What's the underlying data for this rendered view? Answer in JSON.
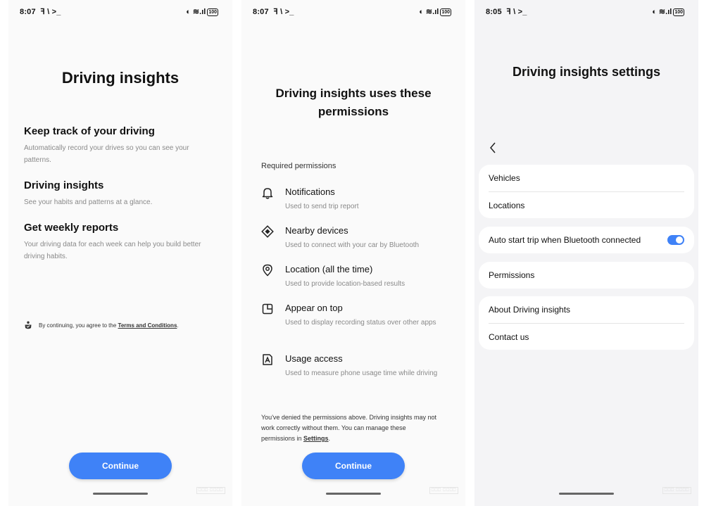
{
  "screen1": {
    "status_time": "8:07",
    "status_icons": "ꟻ \\ >_",
    "battery": "100",
    "title": "Driving insights",
    "features": [
      {
        "title": "Keep track of your driving",
        "desc": "Automatically record your drives so you can see your patterns."
      },
      {
        "title": "Driving insights",
        "desc": "See your habits and patterns at a glance."
      },
      {
        "title": "Get weekly reports",
        "desc": "Your driving data for each week can help you build better driving habits."
      }
    ],
    "terms_prefix": "By continuing, you agree to the ",
    "terms_link": "Terms and Conditions",
    "terms_suffix": ".",
    "continue_label": "Continue"
  },
  "screen2": {
    "status_time": "8:07",
    "status_icons": "ꟻ \\ >_",
    "battery": "100",
    "title_line1": "Driving insights uses these",
    "title_line2": "permissions",
    "required_label": "Required permissions",
    "permissions": [
      {
        "icon": "bell-icon",
        "title": "Notifications",
        "desc": "Used to send trip report"
      },
      {
        "icon": "nearby-devices-icon",
        "title": "Nearby devices",
        "desc": "Used to connect with your car by Bluetooth"
      },
      {
        "icon": "location-pin-icon",
        "title": "Location (all the time)",
        "desc": "Used to provide location-based results"
      },
      {
        "icon": "appear-on-top-icon",
        "title": "Appear on top",
        "desc": "Used to display recording status over other apps"
      },
      {
        "icon": "usage-access-icon",
        "title": "Usage access",
        "desc": "Used to measure phone usage time while driving"
      }
    ],
    "denied_text": "You've denied the permissions above. Driving insights may not work correctly without them. You can manage these permissions in ",
    "settings_link": "Settings",
    "denied_suffix": ".",
    "continue_label": "Continue"
  },
  "screen3": {
    "status_time": "8:05",
    "status_icons": "ꟻ \\ >_",
    "battery": "100",
    "title": "Driving insights settings",
    "vehicles": "Vehicles",
    "locations": "Locations",
    "auto_start": "Auto start trip when Bluetooth connected",
    "auto_start_on": true,
    "permissions": "Permissions",
    "about": "About Driving insights",
    "contact": "Contact us"
  },
  "colors": {
    "accent": "#3f82f7"
  }
}
